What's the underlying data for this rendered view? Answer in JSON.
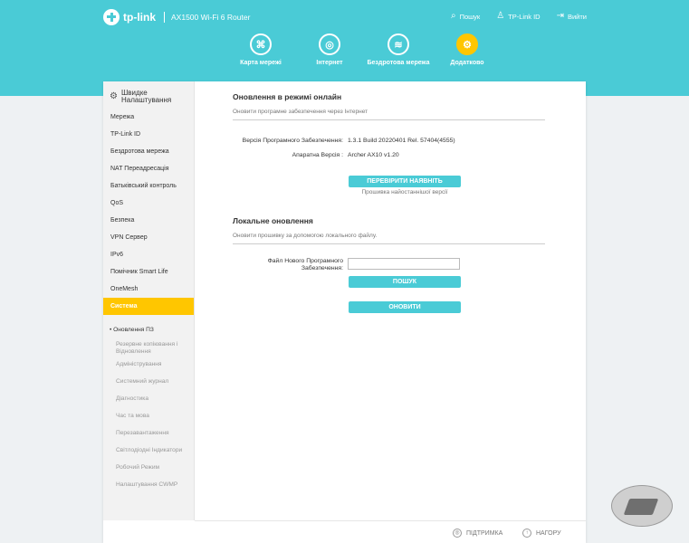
{
  "header": {
    "brand": "tp-link",
    "model": "AX1500 Wi-Fi 6 Router",
    "actions": [
      {
        "label": "Пошук",
        "icon": "search-icon"
      },
      {
        "label": "TP-Link ID",
        "icon": "user-icon"
      },
      {
        "label": "Вийти",
        "icon": "logout-icon"
      }
    ]
  },
  "nav": {
    "tabs": [
      {
        "label": "Карта мережі",
        "icon": "network-map-icon"
      },
      {
        "label": "Інтернет",
        "icon": "globe-icon"
      },
      {
        "label": "Бездротова мережа",
        "icon": "wifi-icon"
      },
      {
        "label": "Додатково",
        "icon": "gear-icon",
        "active": true
      }
    ]
  },
  "sidebar": {
    "quick": "Швидке Налаштування",
    "items": [
      "Мережа",
      "TP-Link ID",
      "Бездротова мережа",
      "NAT Переадресація",
      "Батьківський контроль",
      "QoS",
      "Безпека",
      "VPN Сервер",
      "IPv6",
      "Помічник Smart Life",
      "OneMesh",
      "Система"
    ],
    "active_item": "Система",
    "sub_items": [
      "• Оновлення ПЗ",
      "Резервне копіювання і Відновлення",
      "Адміністрування",
      "Системний журнал",
      "Діагностика",
      "Час та мова",
      "Перезавантаження",
      "Світлодіодні Індикатори",
      "Робочий Режим",
      "Налаштування CWMP"
    ]
  },
  "online": {
    "title": "Оновлення в режимі онлайн",
    "desc": "Оновити програмне забезпечення через Інтернет",
    "firmware_label": "Версія Програмного Забезпечення:",
    "firmware_value": "1.3.1 Build 20220401 Rel. 57404(4555)",
    "hardware_label": "Апаратна Версія :",
    "hardware_value": "Archer AX10 v1.20",
    "check_button": "ПЕРЕВІРИТИ НАЯВНІТЬ ОНОВЛЕНЬ",
    "latest_note": "Прошивка найостаннішої версії"
  },
  "local": {
    "title": "Локальне оновлення",
    "desc": "Оновити прошивку за допомогою локального файлу.",
    "file_label": "Файл Нового Програмного Забезпечення:",
    "file_value": "",
    "browse_button": "ПОШУК",
    "upgrade_button": "ОНОВИТИ"
  },
  "footer": {
    "support": "ПІДТРИМКА",
    "top": "НАГОРУ"
  },
  "colors": {
    "accent": "#4acbd6",
    "active": "#ffc600"
  }
}
